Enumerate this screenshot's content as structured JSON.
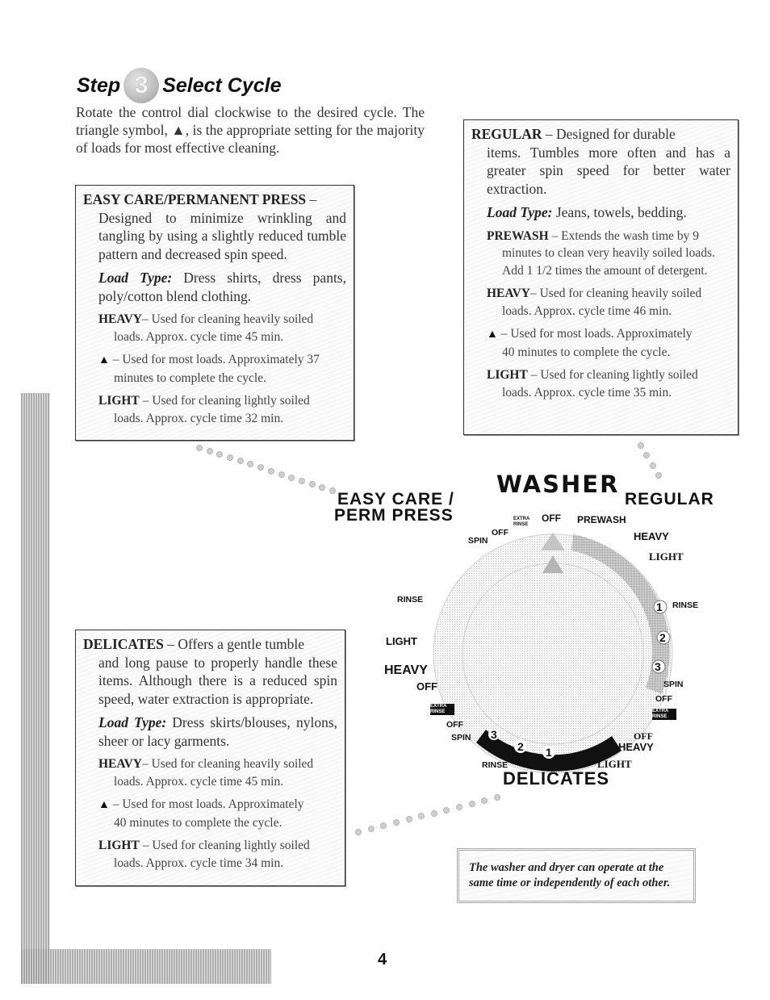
{
  "step": {
    "word": "Step",
    "number": "3",
    "title": "Select Cycle"
  },
  "intro": "Rotate the control dial clockwise to the desired cycle. The triangle symbol, ▲, is the appropriate setting for the majority of loads for most effective cleaning.",
  "easy_care": {
    "name": "EASY CARE/PERMANENT PRESS",
    "dash": " –",
    "description": "Designed to minimize wrinkling and tangling by using a slightly reduced tumble pattern and decreased spin speed.",
    "load_label": "Load Type:",
    "load_value": " Dress shirts, dress pants, poly/cotton blend clothing.",
    "settings": [
      {
        "name": "HEAVY",
        "sep": "– ",
        "line1": "Used for cleaning heavily soiled",
        "line2": "loads. Approx. cycle time 45 min."
      },
      {
        "name": "▲",
        "sep": " – ",
        "line1": "Used for most loads. Approximately 37",
        "line2": "minutes to complete the cycle."
      },
      {
        "name": "LIGHT",
        "sep": " – ",
        "line1": "Used for cleaning lightly soiled",
        "line2": "loads. Approx. cycle time 32 min."
      }
    ]
  },
  "regular": {
    "name": "REGULAR",
    "dash": " – ",
    "description_first": "Designed for durable",
    "description_rest": "items. Tumbles more often and has a greater spin speed for better water extraction.",
    "load_label": "Load Type:",
    "load_value": " Jeans, towels, bedding.",
    "settings": [
      {
        "name": "PREWASH",
        "sep": " – ",
        "line1": "Extends the wash time by 9",
        "line2": "minutes to clean very heavily soiled loads. Add 1 1/2 times the amount of detergent."
      },
      {
        "name": "HEAVY",
        "sep": "– ",
        "line1": "Used for cleaning heavily soiled",
        "line2": "loads. Approx. cycle time 46 min."
      },
      {
        "name": "▲",
        "sep": " – ",
        "line1": "Used for most loads. Approximately",
        "line2": "40 minutes to complete the cycle."
      },
      {
        "name": "LIGHT",
        "sep": " – ",
        "line1": "Used for cleaning lightly soiled",
        "line2": "loads. Approx. cycle time 35 min."
      }
    ]
  },
  "delicates": {
    "name": "DELICATES",
    "dash": " – ",
    "description_first": "Offers a gentle tumble",
    "description_rest": "and long pause to properly handle these items. Although there is a reduced spin speed, water extraction is appropriate.",
    "load_label": "Load Type:",
    "load_value": " Dress skirts/blouses, nylons, sheer or lacy garments.",
    "settings": [
      {
        "name": "HEAVY",
        "sep": "– ",
        "line1": "Used for cleaning heavily soiled",
        "line2": "loads. Approx. cycle time 45 min."
      },
      {
        "name": "▲",
        "sep": " – ",
        "line1": "Used for most loads. Approximately",
        "line2": "40 minutes to complete the cycle."
      },
      {
        "name": "LIGHT",
        "sep": " – ",
        "line1": "Used for cleaning lightly soiled",
        "line2": "loads. Approx. cycle time 34 min."
      }
    ]
  },
  "dial": {
    "title": "WASHER",
    "easy_care_label_1": "EASY CARE /",
    "easy_care_label_2": "PERM PRESS",
    "regular_label": "REGULAR",
    "delicates_label": "DELICATES",
    "labels": {
      "spin_top": "SPIN",
      "off_top_left": "OFF",
      "extra_rinse": "EXTRA RINSE",
      "off_top": "OFF",
      "prewash": "PREWASH",
      "heavy_right": "HEAVY",
      "light_right": "LIGHT",
      "rinse_right": "RINSE",
      "spin_right": "SPIN",
      "off_right": "OFF",
      "extra_rinse_right": "EXTRA RINSE",
      "off_bottom_right": "OFF",
      "heavy_bottom_right": "HEAVY",
      "light_bottom": "LIGHT",
      "rinse_bottom": "RINSE",
      "spin_bottom": "SPIN",
      "off_bottom_left": "OFF",
      "extra_rinse_left": "EXTRA RINSE",
      "off_left": "OFF",
      "heavy_left": "HEAVY",
      "light_left": "LIGHT",
      "rinse_left": "RINSE"
    },
    "numbers": [
      "1",
      "2",
      "3"
    ]
  },
  "note": "The washer and dryer can operate at the same time or independently of each other.",
  "page_number": "4"
}
